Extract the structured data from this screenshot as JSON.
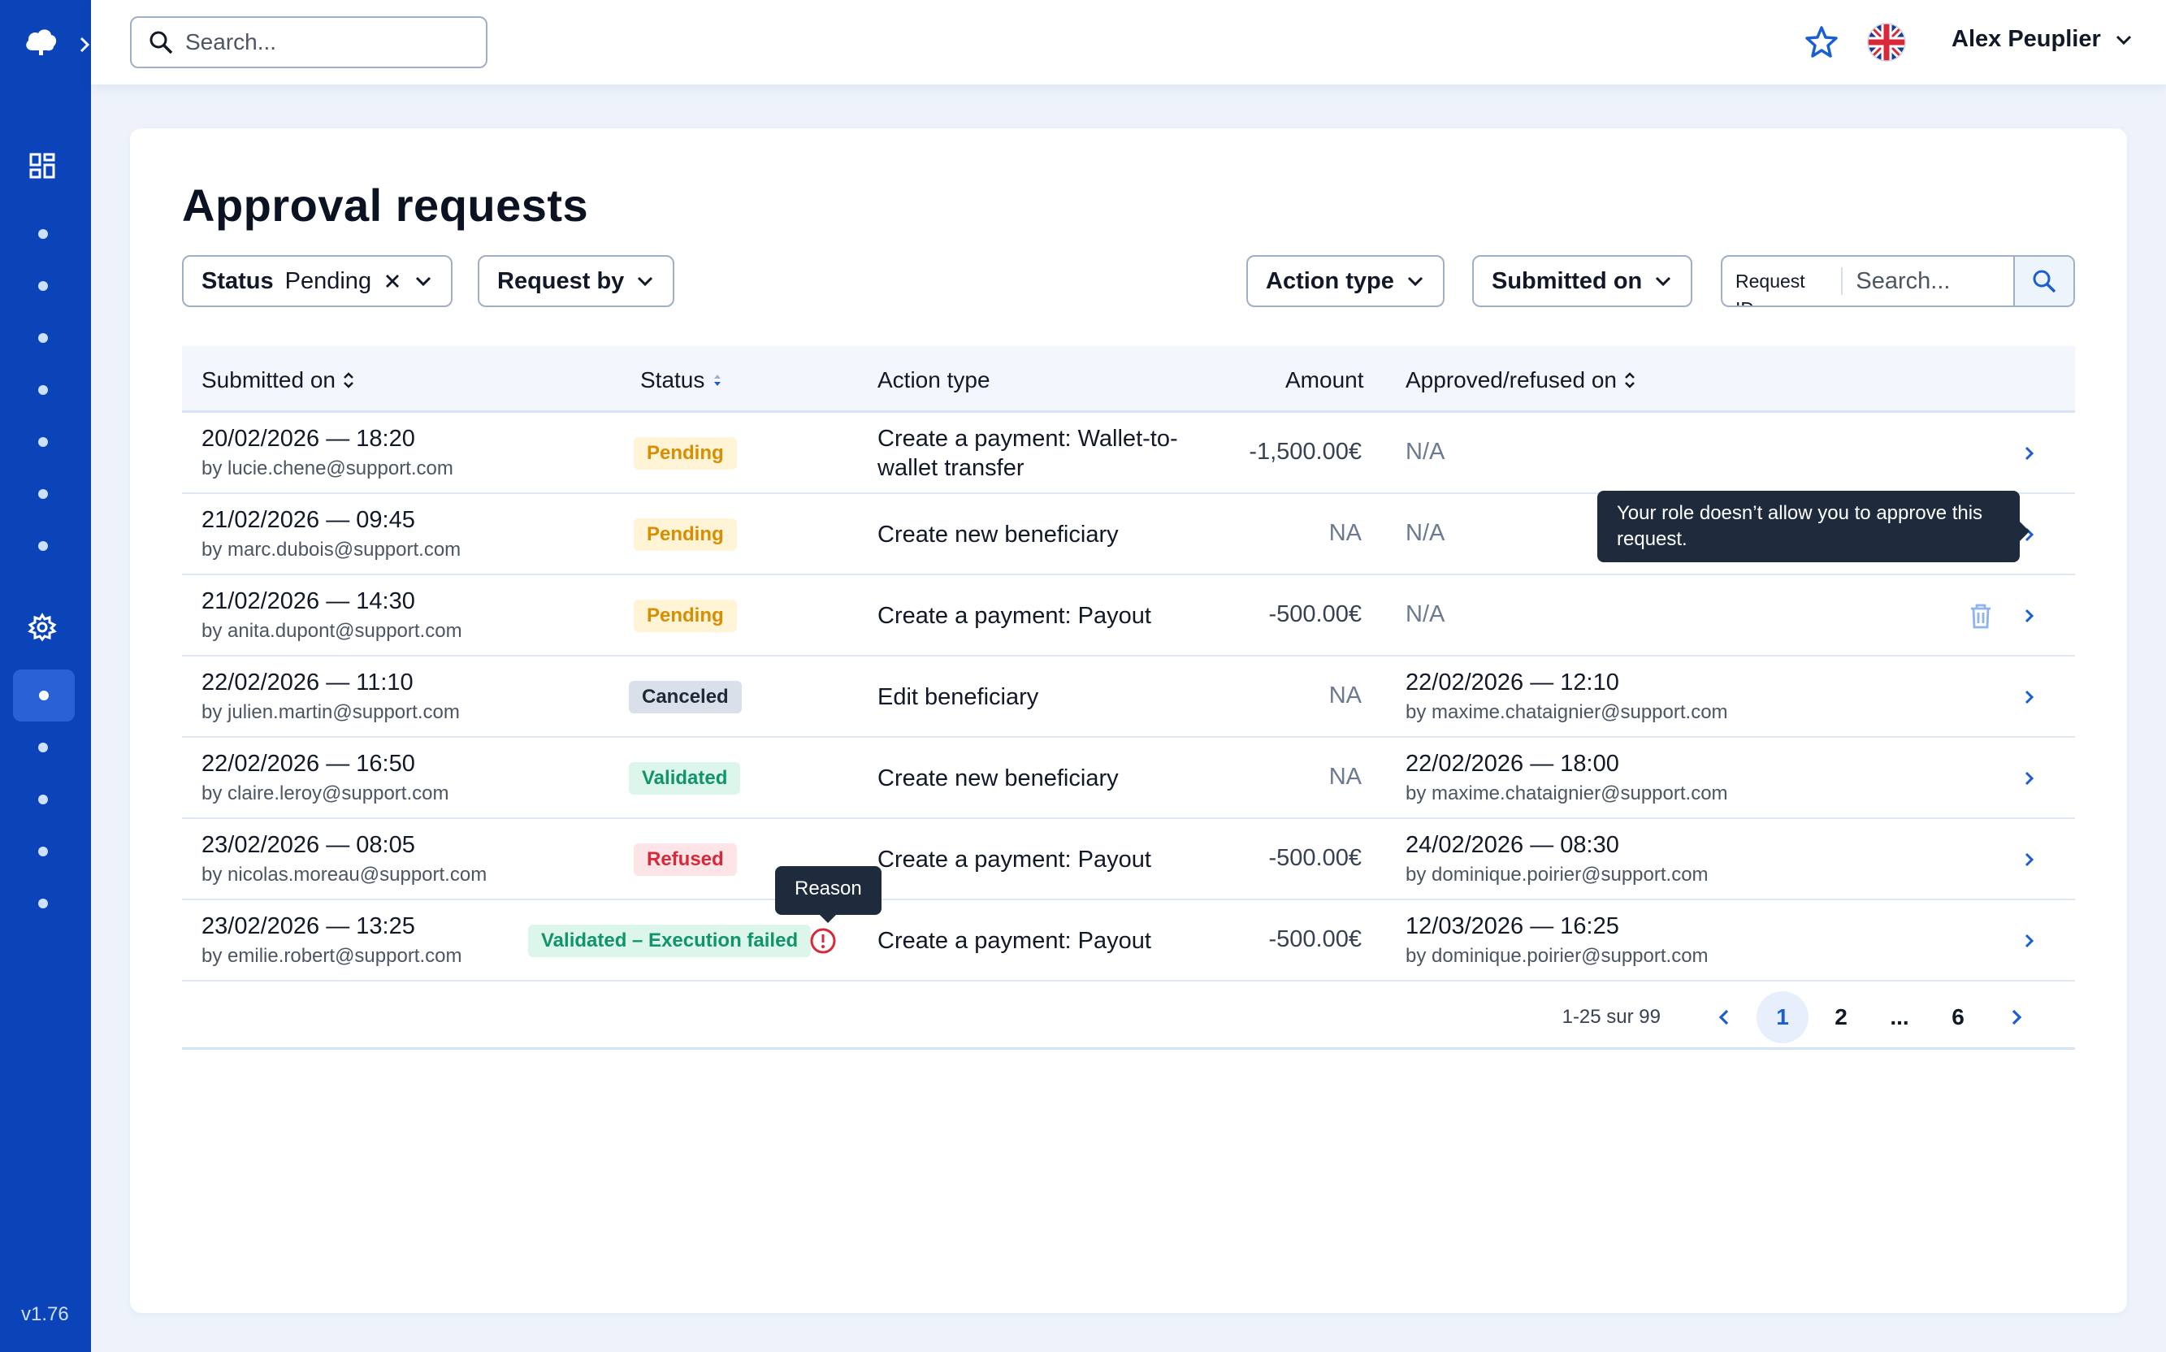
{
  "app": {
    "version": "v1.76"
  },
  "search": {
    "placeholder": "Search..."
  },
  "user": {
    "name": "Alex Peuplier"
  },
  "page": {
    "title": "Approval requests"
  },
  "filters": {
    "status_label": "Status",
    "status_value": "Pending",
    "request_by": "Request by",
    "action_type": "Action type",
    "submitted_on": "Submitted on",
    "request_id_label": "Request ID",
    "request_id_placeholder": "Search..."
  },
  "table": {
    "headers": {
      "submitted_on": "Submitted on",
      "status": "Status",
      "action_type": "Action type",
      "amount": "Amount",
      "approved_on": "Approved/refused on"
    },
    "rows": [
      {
        "date": "20/02/2026 — 18:20",
        "by": "by lucie.chene@support.com",
        "status": "Pending",
        "action": "Create a payment: Wallet-to-wallet transfer",
        "amount": "-1,500.00€",
        "approved": "N/A",
        "approved_by": ""
      },
      {
        "date": "21/02/2026 — 09:45",
        "by": "by marc.dubois@support.com",
        "status": "Pending",
        "action": "Create new beneficiary",
        "amount": "NA",
        "approved": "N/A",
        "approved_by": ""
      },
      {
        "date": "21/02/2026 — 14:30",
        "by": "by anita.dupont@support.com",
        "status": "Pending",
        "action": "Create a payment: Payout",
        "amount": "-500.00€",
        "approved": "N/A",
        "approved_by": ""
      },
      {
        "date": "22/02/2026 — 11:10",
        "by": "by julien.martin@support.com",
        "status": "Canceled",
        "action": "Edit beneficiary",
        "amount": "NA",
        "approved": "22/02/2026 — 12:10",
        "approved_by": "by maxime.chataignier@support.com"
      },
      {
        "date": "22/02/2026 — 16:50",
        "by": "by claire.leroy@support.com",
        "status": "Validated",
        "action": "Create new beneficiary",
        "amount": "NA",
        "approved": "22/02/2026 — 18:00",
        "approved_by": "by maxime.chataignier@support.com"
      },
      {
        "date": "23/02/2026 — 08:05",
        "by": "by nicolas.moreau@support.com",
        "status": "Refused",
        "action": "Create a payment: Payout",
        "amount": "-500.00€",
        "approved": "24/02/2026 — 08:30",
        "approved_by": "by dominique.poirier@support.com"
      },
      {
        "date": "23/02/2026 — 13:25",
        "by": "by emilie.robert@support.com",
        "status": "Validated – Execution failed",
        "action": "Create a payment: Payout",
        "amount": "-500.00€",
        "approved": "12/03/2026 — 16:25",
        "approved_by": "by dominique.poirier@support.com"
      }
    ]
  },
  "tooltips": {
    "role": "Your role doesn’t allow you to approve this request.",
    "reason": "Reason"
  },
  "pagination": {
    "info": "1-25 sur 99",
    "pages": [
      "1",
      "2",
      "...",
      "6"
    ],
    "current": "1"
  },
  "colors": {
    "sidebar": "#0b44b8",
    "accent": "#1a5fd1",
    "pending": "#d98d00",
    "validated": "#12946a",
    "refused": "#d8283a"
  },
  "icons": {
    "logo": "cloud-logo-icon",
    "expand": "chevron-right-icon",
    "dashboard": "dashboard-grid-icon",
    "settings": "gear-icon",
    "search": "search-icon",
    "favorite": "star-icon",
    "language": "uk-flag-icon",
    "trash": "trash-icon",
    "error": "alert-circle-icon"
  }
}
